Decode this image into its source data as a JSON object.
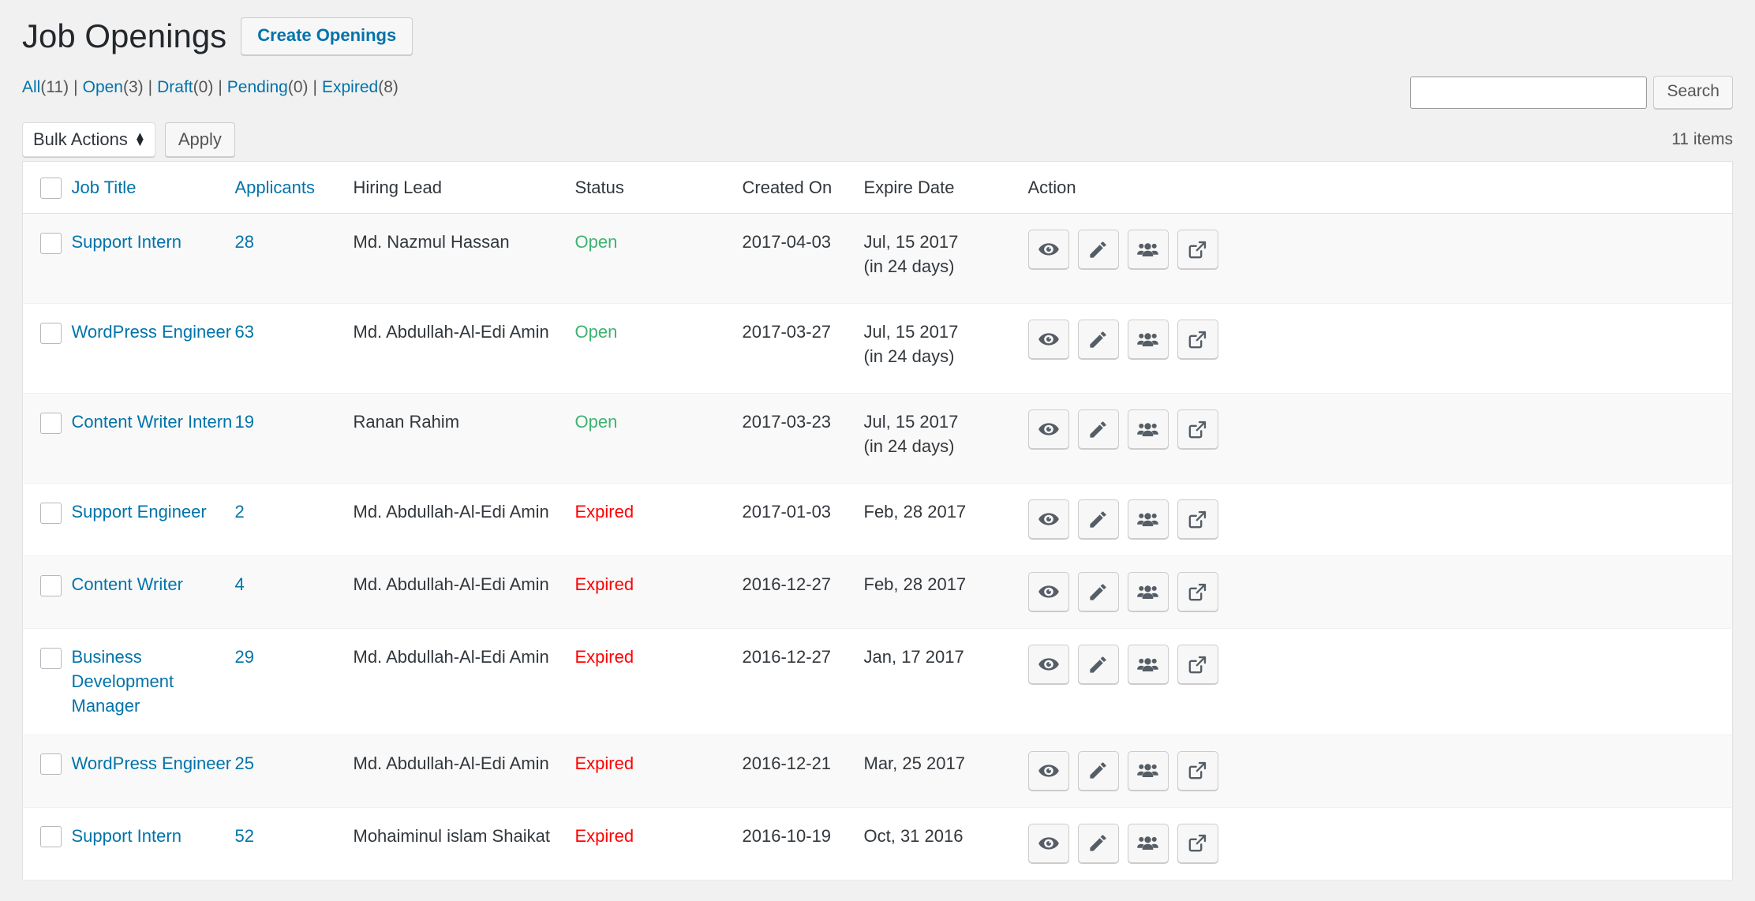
{
  "header": {
    "title": "Job Openings",
    "create_button": "Create Openings"
  },
  "filters": [
    {
      "label": "All",
      "count": "(11)"
    },
    {
      "label": "Open",
      "count": "(3)"
    },
    {
      "label": "Draft",
      "count": "(0)"
    },
    {
      "label": "Pending",
      "count": "(0)"
    },
    {
      "label": "Expired",
      "count": "(8)"
    }
  ],
  "filter_separator": "|",
  "search": {
    "value": "",
    "placeholder": "",
    "button_label": "Search"
  },
  "tablenav": {
    "bulk_actions_label": "Bulk Actions",
    "bulk_actions_options": [
      "Bulk Actions"
    ],
    "apply_label": "Apply",
    "items_count": "11 items"
  },
  "table": {
    "columns": [
      {
        "key": "cb",
        "label": "",
        "link": false
      },
      {
        "key": "title",
        "label": "Job Title",
        "link": true
      },
      {
        "key": "appl",
        "label": "Applicants",
        "link": true
      },
      {
        "key": "lead",
        "label": "Hiring Lead",
        "link": false
      },
      {
        "key": "status",
        "label": "Status",
        "link": false
      },
      {
        "key": "created",
        "label": "Created On",
        "link": false
      },
      {
        "key": "expire",
        "label": "Expire Date",
        "link": false
      },
      {
        "key": "action",
        "label": "Action",
        "link": false
      }
    ],
    "action_icons": [
      {
        "name": "eye-icon",
        "title": "View"
      },
      {
        "name": "pencil-icon",
        "title": "Edit"
      },
      {
        "name": "users-icon",
        "title": "Applicants"
      },
      {
        "name": "external-link-icon",
        "title": "Open"
      }
    ],
    "rows": [
      {
        "title": "Support Intern",
        "applicants": "28",
        "hiring_lead": "Md. Nazmul Hassan",
        "status": "Open",
        "status_kind": "open",
        "created_on": "2017-04-03",
        "expire_date": "Jul, 15 2017",
        "expire_relative": "(in 24 days)"
      },
      {
        "title": "WordPress Engineer",
        "applicants": "63",
        "hiring_lead": "Md. Abdullah-Al-Edi Amin",
        "status": "Open",
        "status_kind": "open",
        "created_on": "2017-03-27",
        "expire_date": "Jul, 15 2017",
        "expire_relative": "(in 24 days)"
      },
      {
        "title": "Content Writer Intern",
        "applicants": "19",
        "hiring_lead": "Ranan Rahim",
        "status": "Open",
        "status_kind": "open",
        "created_on": "2017-03-23",
        "expire_date": "Jul, 15 2017",
        "expire_relative": "(in 24 days)"
      },
      {
        "title": "Support Engineer",
        "applicants": "2",
        "hiring_lead": "Md. Abdullah-Al-Edi Amin",
        "status": "Expired",
        "status_kind": "expired",
        "created_on": "2017-01-03",
        "expire_date": "Feb, 28 2017",
        "expire_relative": ""
      },
      {
        "title": "Content Writer",
        "applicants": "4",
        "hiring_lead": "Md. Abdullah-Al-Edi Amin",
        "status": "Expired",
        "status_kind": "expired",
        "created_on": "2016-12-27",
        "expire_date": "Feb, 28 2017",
        "expire_relative": ""
      },
      {
        "title": "Business Development Manager",
        "applicants": "29",
        "hiring_lead": "Md. Abdullah-Al-Edi Amin",
        "status": "Expired",
        "status_kind": "expired",
        "created_on": "2016-12-27",
        "expire_date": "Jan, 17 2017",
        "expire_relative": ""
      },
      {
        "title": "WordPress Engineer",
        "applicants": "25",
        "hiring_lead": "Md. Abdullah-Al-Edi Amin",
        "status": "Expired",
        "status_kind": "expired",
        "created_on": "2016-12-21",
        "expire_date": "Mar, 25 2017",
        "expire_relative": ""
      },
      {
        "title": "Support Intern",
        "applicants": "52",
        "hiring_lead": "Mohaiminul islam Shaikat",
        "status": "Expired",
        "status_kind": "expired",
        "created_on": "2016-10-19",
        "expire_date": "Oct, 31 2016",
        "expire_relative": ""
      }
    ]
  },
  "colors": {
    "link": "#0073aa",
    "status_open": "#3eb370",
    "status_expired": "#ff0000",
    "page_bg": "#f1f1f1",
    "row_alt_bg": "#f9f9f9"
  }
}
